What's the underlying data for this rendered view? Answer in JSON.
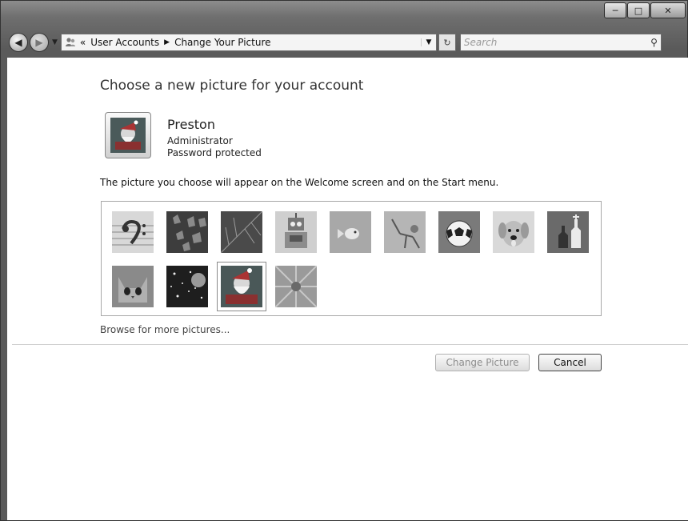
{
  "window": {
    "caption_buttons": [
      "minimize",
      "maximize",
      "close"
    ]
  },
  "addressbar": {
    "chevrons": "«",
    "crumb1": "User Accounts",
    "crumb2": "Change Your Picture",
    "search_placeholder": "Search"
  },
  "page": {
    "heading": "Choose a new picture for your account",
    "account": {
      "name": "Preston",
      "role": "Administrator",
      "status": "Password protected"
    },
    "description": "The picture you choose will appear on the Welcome screen and on the Start menu.",
    "pictures": [
      {
        "name": "bass-clef-picture",
        "icon": "music"
      },
      {
        "name": "crystals-picture",
        "icon": "crystal"
      },
      {
        "name": "leaf-picture",
        "icon": "leaf"
      },
      {
        "name": "robot-picture",
        "icon": "robot"
      },
      {
        "name": "goldfish-picture",
        "icon": "fish"
      },
      {
        "name": "stick-figure-picture",
        "icon": "figure"
      },
      {
        "name": "soccer-ball-picture",
        "icon": "ball"
      },
      {
        "name": "puppy-picture",
        "icon": "dog"
      },
      {
        "name": "chess-picture",
        "icon": "chess"
      },
      {
        "name": "kitten-picture",
        "icon": "cat"
      },
      {
        "name": "sparkles-picture",
        "icon": "sparkle"
      },
      {
        "name": "santa-picture",
        "icon": "santa",
        "selected": true
      },
      {
        "name": "flower-picture",
        "icon": "flower"
      }
    ],
    "browse_link": "Browse for more pictures...",
    "change_button": "Change Picture",
    "cancel_button": "Cancel"
  }
}
